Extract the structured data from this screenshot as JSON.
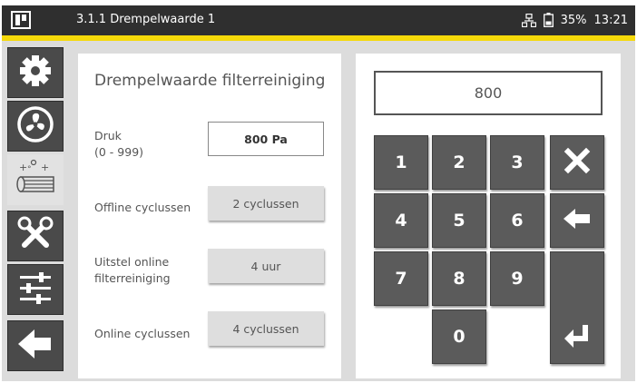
{
  "header": {
    "title": "3.1.1 Drempelwaarde 1",
    "battery": "35%",
    "time": "13:21"
  },
  "sidebar": {
    "items": [
      {
        "icon": "gear-icon"
      },
      {
        "icon": "fan-icon"
      },
      {
        "icon": "filter-cleaning-icon",
        "label": "+°+"
      },
      {
        "icon": "tools-icon"
      },
      {
        "icon": "sliders-icon"
      },
      {
        "icon": "back-arrow-icon"
      }
    ]
  },
  "settings": {
    "title": "Drempelwaarde filterreiniging",
    "rows": [
      {
        "label_line1": "Druk",
        "label_line2": "(0 - 999)",
        "value": "800 Pa"
      },
      {
        "label_line1": "Offline cyclussen",
        "label_line2": "",
        "value": "2 cyclussen"
      },
      {
        "label_line1": "Uitstel online",
        "label_line2": "filterreiniging",
        "value": "4 uur"
      },
      {
        "label_line1": "Online cyclussen",
        "label_line2": "",
        "value": "4 cyclussen"
      }
    ]
  },
  "keypad": {
    "display": "800",
    "keys": [
      "1",
      "2",
      "3",
      "4",
      "5",
      "6",
      "7",
      "8",
      "9",
      "0"
    ]
  },
  "colors": {
    "accent": "#f5d90a",
    "topbar": "#2f2f2f",
    "key": "#5b5b5b"
  }
}
